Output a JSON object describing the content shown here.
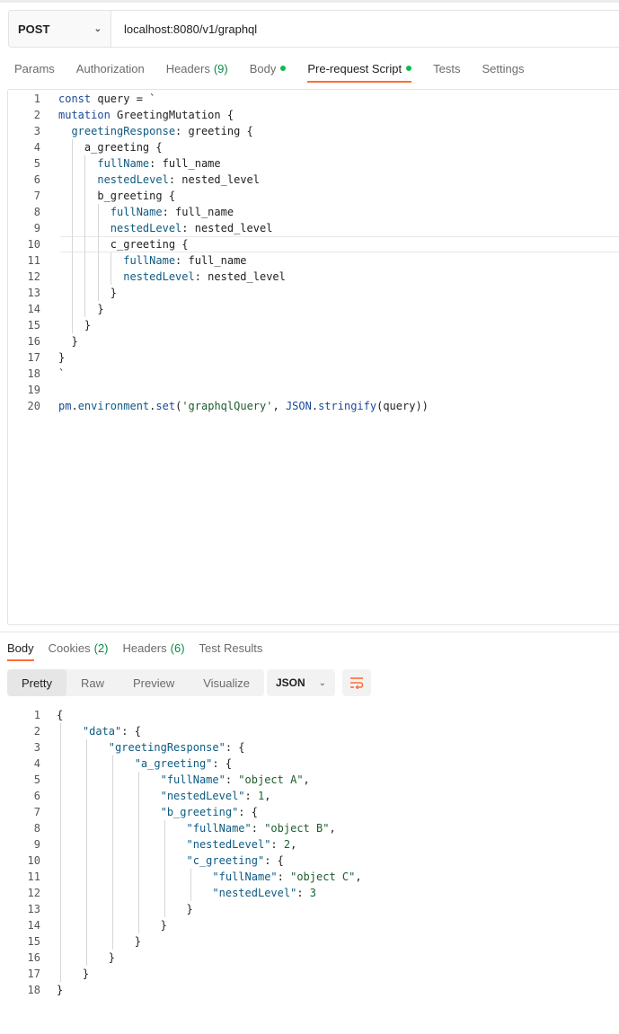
{
  "request": {
    "method": "POST",
    "url": "localhost:8080/v1/graphql"
  },
  "request_tabs": [
    {
      "label": "Params"
    },
    {
      "label": "Authorization"
    },
    {
      "label": "Headers",
      "count": "(9)"
    },
    {
      "label": "Body"
    },
    {
      "label": "Pre-request Script"
    },
    {
      "label": "Tests"
    },
    {
      "label": "Settings"
    }
  ],
  "script_lines": [
    {
      "n": "1",
      "t": "const query = `"
    },
    {
      "n": "2",
      "t": "mutation GreetingMutation {"
    },
    {
      "n": "3",
      "t": "  greetingResponse: greeting {"
    },
    {
      "n": "4",
      "t": "    a_greeting {"
    },
    {
      "n": "5",
      "t": "      fullName: full_name"
    },
    {
      "n": "6",
      "t": "      nestedLevel: nested_level"
    },
    {
      "n": "7",
      "t": "      b_greeting {"
    },
    {
      "n": "8",
      "t": "        fullName: full_name"
    },
    {
      "n": "9",
      "t": "        nestedLevel: nested_level"
    },
    {
      "n": "10",
      "t": "        c_greeting {"
    },
    {
      "n": "11",
      "t": "          fullName: full_name"
    },
    {
      "n": "12",
      "t": "          nestedLevel: nested_level"
    },
    {
      "n": "13",
      "t": "        }"
    },
    {
      "n": "14",
      "t": "      }"
    },
    {
      "n": "15",
      "t": "    }"
    },
    {
      "n": "16",
      "t": "  }"
    },
    {
      "n": "17",
      "t": "}"
    },
    {
      "n": "18",
      "t": "`"
    },
    {
      "n": "19",
      "t": ""
    },
    {
      "n": "20",
      "t": "pm.environment.set('graphqlQuery', JSON.stringify(query))"
    }
  ],
  "response_tabs": [
    {
      "label": "Body"
    },
    {
      "label": "Cookies",
      "count": "(2)"
    },
    {
      "label": "Headers",
      "count": "(6)"
    },
    {
      "label": "Test Results"
    }
  ],
  "view_modes": [
    "Pretty",
    "Raw",
    "Preview",
    "Visualize"
  ],
  "format": "JSON",
  "response_lines": [
    {
      "n": "1",
      "t": "{"
    },
    {
      "n": "2",
      "t": "    \"data\": {"
    },
    {
      "n": "3",
      "t": "        \"greetingResponse\": {"
    },
    {
      "n": "4",
      "t": "            \"a_greeting\": {"
    },
    {
      "n": "5",
      "t": "                \"fullName\": \"object A\","
    },
    {
      "n": "6",
      "t": "                \"nestedLevel\": 1,"
    },
    {
      "n": "7",
      "t": "                \"b_greeting\": {"
    },
    {
      "n": "8",
      "t": "                    \"fullName\": \"object B\","
    },
    {
      "n": "9",
      "t": "                    \"nestedLevel\": 2,"
    },
    {
      "n": "10",
      "t": "                    \"c_greeting\": {"
    },
    {
      "n": "11",
      "t": "                        \"fullName\": \"object C\","
    },
    {
      "n": "12",
      "t": "                        \"nestedLevel\": 3"
    },
    {
      "n": "13",
      "t": "                    }"
    },
    {
      "n": "14",
      "t": "                }"
    },
    {
      "n": "15",
      "t": "            }"
    },
    {
      "n": "16",
      "t": "        }"
    },
    {
      "n": "17",
      "t": "    }"
    },
    {
      "n": "18",
      "t": "}"
    }
  ],
  "colors": {
    "accent": "#ff6c37",
    "status_dot": "#0cbb52",
    "count_green": "#0c8a47"
  },
  "icons": {
    "method_dropdown": "chevron-down-icon",
    "format_dropdown": "chevron-down-icon",
    "wrap": "wrap-lines-icon"
  }
}
